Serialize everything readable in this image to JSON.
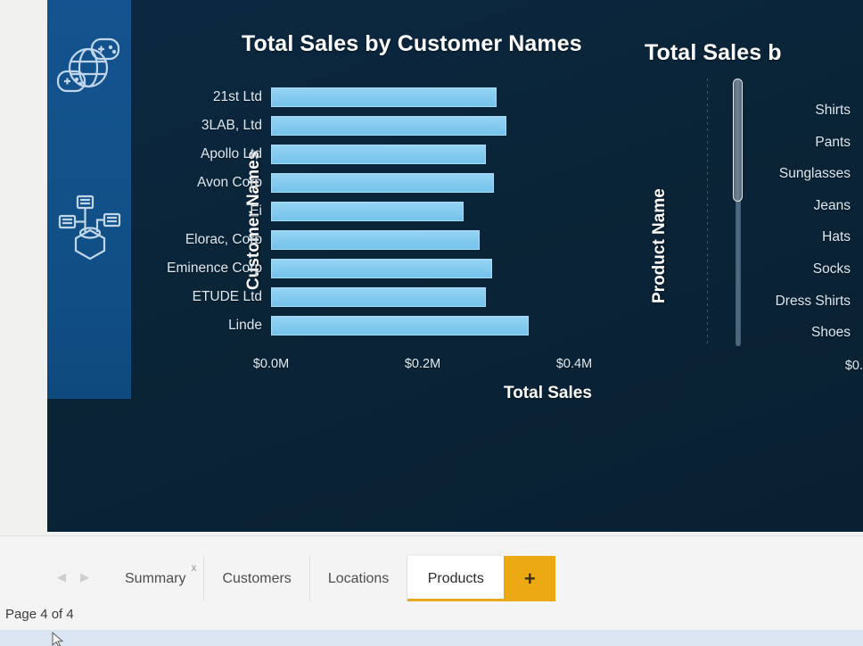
{
  "window": {
    "canvas_bg": "#0a2437",
    "sidebar_color": "#14538f",
    "accent_orange": "#eda913",
    "bar_color": "#84cbf0"
  },
  "report_sidebar": {
    "icons": [
      {
        "name": "globe-gamepad-icon",
        "label": "Globe and gamepads graphic"
      },
      {
        "name": "network-database-icon",
        "label": "Network database diagram"
      }
    ]
  },
  "chart_data": [
    {
      "id": "left",
      "type": "bar",
      "orientation": "horizontal",
      "title": "Total Sales by Customer Names",
      "xlabel": "Total Sales",
      "ylabel": "Customer Names",
      "categories": [
        "21st Ltd",
        "3LAB, Ltd",
        "Apollo Ltd",
        "Avon Corp",
        "Ei",
        "Elorac, Corp",
        "Eminence Corp",
        "ETUDE Ltd",
        "Linde"
      ],
      "values": [
        0.298,
        0.311,
        0.283,
        0.294,
        0.254,
        0.275,
        0.292,
        0.283,
        0.34
      ],
      "value_unit": "M",
      "xlim": [
        0,
        0.4
      ],
      "xticks": [
        0,
        0.2,
        0.4
      ],
      "xticklabels": [
        "$0.0M",
        "$0.2M",
        "$0.4M"
      ],
      "grid": "dotted-vertical",
      "legend": "none"
    },
    {
      "id": "right",
      "type": "bar",
      "orientation": "horizontal",
      "title": "Total Sales b",
      "title_truncated": true,
      "ylabel": "Product Name",
      "categories": [
        "Shirts",
        "Pants",
        "Sunglasses",
        "Jeans",
        "Hats",
        "Socks",
        "Dress Shirts",
        "Shoes"
      ],
      "xticklabels": [
        "$0."
      ],
      "clipped": true
    }
  ],
  "scrollbar": {
    "name": "chart-vertical-scrollbar",
    "thumb_position_pct": 0,
    "thumb_size_pct": 46
  },
  "tabbar": {
    "nav": {
      "prev": "◀",
      "next": "▶"
    },
    "tabs": [
      {
        "label": "Summary",
        "active": false,
        "closable": true,
        "close_label": "x"
      },
      {
        "label": "Customers",
        "active": false,
        "closable": false
      },
      {
        "label": "Locations",
        "active": false,
        "closable": false
      },
      {
        "label": "Products",
        "active": true,
        "closable": false
      }
    ],
    "add_label": "+"
  },
  "statusbar": {
    "page_text": "Page 4 of 4"
  }
}
